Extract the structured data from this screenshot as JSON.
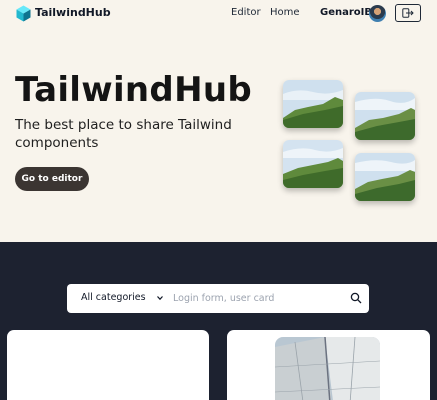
{
  "header": {
    "brand": "TailwindHub",
    "nav": [
      {
        "label": "Editor"
      },
      {
        "label": "Home"
      }
    ],
    "username": "GenaroIBC"
  },
  "hero": {
    "title": "TailwindHub",
    "subtitle": "The best place to share Tailwind components",
    "cta_label": "Go to editor"
  },
  "search": {
    "category_selected": "All categories",
    "placeholder": "Login form, user card"
  },
  "colors": {
    "hero_bg": "#f8f4ec",
    "dark_bg": "#1d2230",
    "cta_bg": "#3b3532",
    "logo_accent": "#22b8cf"
  },
  "icons": [
    "cube-logo-icon",
    "logout-icon",
    "chevron-down-icon",
    "search-icon"
  ]
}
